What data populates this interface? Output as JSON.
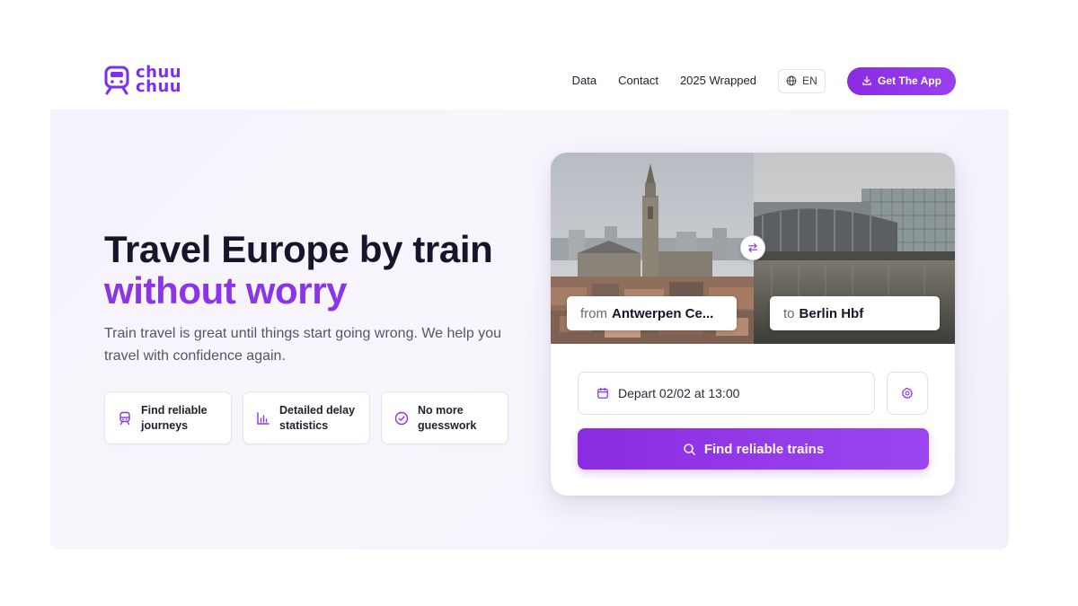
{
  "brand": {
    "line1": "chuu",
    "line2": "chuu",
    "logo_icon": "train-face-icon",
    "color": "#7b2ff0"
  },
  "nav": {
    "links": [
      "Data",
      "Contact",
      "2025 Wrapped"
    ],
    "language": "EN",
    "language_icon": "globe-icon",
    "cta_label": "Get The App",
    "cta_icon": "download-icon"
  },
  "hero": {
    "headline_line1": "Travel Europe by train",
    "headline_line2": "without worry",
    "subtext": "Train travel is great until things start going wrong. We help you travel with confidence again.",
    "features": [
      {
        "icon": "train-icon",
        "label": "Find reliable journeys"
      },
      {
        "icon": "bar-chart-icon",
        "label": "Detailed delay statistics"
      },
      {
        "icon": "check-circle-icon",
        "label": "No more guesswork"
      }
    ]
  },
  "search": {
    "from_prefix": "from",
    "from_station": "Antwerpen Ce...",
    "to_prefix": "to",
    "to_station": "Berlin Hbf",
    "swap_icon": "swap-arrows-icon",
    "depart_label": "Depart 02/02 at 13:00",
    "depart_icon": "calendar-icon",
    "settings_icon": "gear-icon",
    "submit_label": "Find reliable trains",
    "submit_icon": "search-icon"
  },
  "colors": {
    "accent": "#8a35e6",
    "button": "#8b2be2",
    "heading": "#15162a"
  }
}
